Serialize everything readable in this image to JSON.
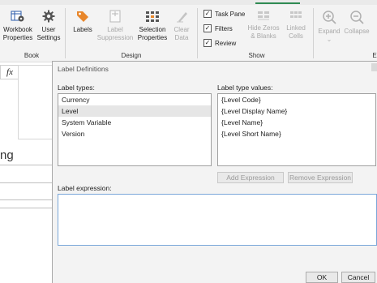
{
  "ribbon": {
    "groups": {
      "book": "Book",
      "design": "Design",
      "show": "Show",
      "edge": "E"
    },
    "workbook_properties": {
      "line1": "Workbook",
      "line2": "Properties"
    },
    "user_settings": {
      "line1": "User",
      "line2": "Settings"
    },
    "labels": "Labels",
    "label_suppression": {
      "line1": "Label",
      "line2": "Suppression"
    },
    "selection_properties": {
      "line1": "Selection",
      "line2": "Properties"
    },
    "clear_data": {
      "line1": "Clear",
      "line2": "Data"
    },
    "task_pane": "Task Pane",
    "filters": "Filters",
    "review": "Review",
    "hide_zeros": {
      "line1": "Hide Zeros",
      "line2": "& Blanks"
    },
    "linked_cells": {
      "line1": "Linked",
      "line2": "Cells"
    },
    "expand": "Expand",
    "collapse": "Collapse"
  },
  "sheet": {
    "fx": "fx",
    "partial_text": "ng"
  },
  "dialog": {
    "title": "Label Definitions",
    "label_types_heading": "Label types:",
    "label_types": [
      "Currency",
      "Level",
      "System Variable",
      "Version"
    ],
    "selected_type": "Level",
    "label_type_values_heading": "Label type values:",
    "label_type_values": [
      "{Level Code}",
      "{Level Display Name}",
      "{Level Name}",
      "{Level Short Name}"
    ],
    "add_expression": "Add Expression",
    "remove_expression": "Remove Expression",
    "label_expression_heading": "Label expression:",
    "label_expression_value": "",
    "ok": "OK",
    "cancel": "Cancel"
  },
  "colors": {
    "accent": "#2f8a52",
    "icon_orange": "#e8862a",
    "icon_blue": "#2a5aa8",
    "focus_border": "#7aa7d9"
  }
}
